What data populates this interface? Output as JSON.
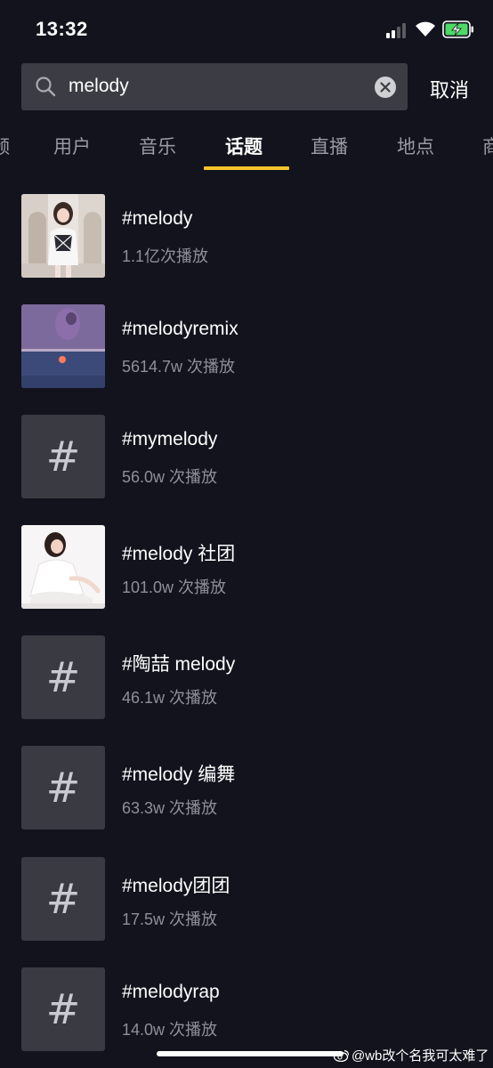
{
  "status_bar": {
    "time": "13:32"
  },
  "search": {
    "query": "melody",
    "cancel_label": "取消"
  },
  "tabs": [
    {
      "label": "频",
      "active": false
    },
    {
      "label": "用户",
      "active": false
    },
    {
      "label": "音乐",
      "active": false
    },
    {
      "label": "话题",
      "active": true
    },
    {
      "label": "直播",
      "active": false
    },
    {
      "label": "地点",
      "active": false
    },
    {
      "label": "商",
      "active": false
    }
  ],
  "results": [
    {
      "title": "#melody",
      "plays": "1.1亿次播放",
      "thumb": "photo-girl-outdoor"
    },
    {
      "title": "#melodyremix",
      "plays": "5614.7w 次播放",
      "thumb": "photo-purple-scene"
    },
    {
      "title": "#mymelody",
      "plays": "56.0w 次播放",
      "thumb": "hash-icon"
    },
    {
      "title": "#melody 社团",
      "plays": "101.0w 次播放",
      "thumb": "photo-girl-white"
    },
    {
      "title": "#陶喆 melody",
      "plays": "46.1w 次播放",
      "thumb": "hash-icon"
    },
    {
      "title": "#melody 编舞",
      "plays": "63.3w 次播放",
      "thumb": "hash-icon"
    },
    {
      "title": "#melody团团",
      "plays": "17.5w 次播放",
      "thumb": "hash-icon"
    },
    {
      "title": "#melodyrap",
      "plays": "14.0w 次播放",
      "thumb": "hash-icon"
    }
  ],
  "hash_glyph": "#",
  "watermark": "@wb改个名我可太难了",
  "colors": {
    "background": "#13131e",
    "search_bg": "#3c3d44",
    "accent_underline": "#f6c62b",
    "muted_text": "#8f8f97"
  }
}
